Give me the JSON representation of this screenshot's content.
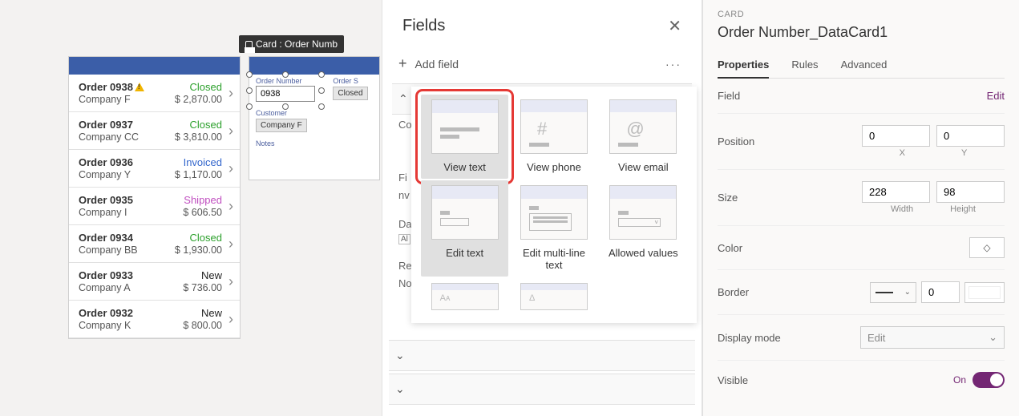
{
  "orders": [
    {
      "title": "Order 0938",
      "company": "Company F",
      "status": "Closed",
      "status_class": "closed",
      "amount": "$ 2,870.00",
      "warn": true
    },
    {
      "title": "Order 0937",
      "company": "Company CC",
      "status": "Closed",
      "status_class": "closed",
      "amount": "$ 3,810.00",
      "warn": false
    },
    {
      "title": "Order 0936",
      "company": "Company Y",
      "status": "Invoiced",
      "status_class": "invoiced",
      "amount": "$ 1,170.00",
      "warn": false
    },
    {
      "title": "Order 0935",
      "company": "Company I",
      "status": "Shipped",
      "status_class": "shipped",
      "amount": "$ 606.50",
      "warn": false
    },
    {
      "title": "Order 0934",
      "company": "Company BB",
      "status": "Closed",
      "status_class": "closed",
      "amount": "$ 1,930.00",
      "warn": false
    },
    {
      "title": "Order 0933",
      "company": "Company A",
      "status": "New",
      "status_class": "new",
      "amount": "$ 736.00",
      "warn": false
    },
    {
      "title": "Order 0932",
      "company": "Company K",
      "status": "New",
      "status_class": "new",
      "amount": "$ 800.00",
      "warn": false
    }
  ],
  "tooltip": "Card : Order Numb",
  "canvas": {
    "order_number_label": "Order Number",
    "order_number_value": "0938",
    "order_status_label": "Order S",
    "order_status_value": "Closed",
    "customer_label": "Customer",
    "customer_value": "Company F",
    "notes_label": "Notes"
  },
  "fields_panel": {
    "title": "Fields",
    "add_field": "Add field",
    "bg_labels": [
      "Co",
      "Fi",
      "nv",
      "Da",
      "Al",
      "Re",
      "No"
    ],
    "types": [
      {
        "label": "View text"
      },
      {
        "label": "View phone"
      },
      {
        "label": "View email"
      },
      {
        "label": "Edit text"
      },
      {
        "label": "Edit multi-line text"
      },
      {
        "label": "Allowed values"
      }
    ]
  },
  "props": {
    "breadcrumb": "CARD",
    "title": "Order Number_DataCard1",
    "tabs": {
      "properties": "Properties",
      "rules": "Rules",
      "advanced": "Advanced"
    },
    "field_label": "Field",
    "edit_link": "Edit",
    "position_label": "Position",
    "pos_x": "0",
    "pos_y": "0",
    "x_label": "X",
    "y_label": "Y",
    "size_label": "Size",
    "width": "228",
    "height": "98",
    "w_label": "Width",
    "h_label": "Height",
    "color_label": "Color",
    "border_label": "Border",
    "border_value": "0",
    "display_mode_label": "Display mode",
    "display_mode_value": "Edit",
    "visible_label": "Visible",
    "visible_state": "On"
  }
}
